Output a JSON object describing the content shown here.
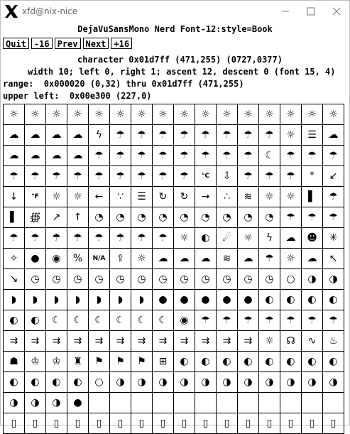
{
  "window": {
    "title": "xfd@nix-nice"
  },
  "font_name": "DejaVuSansMono Nerd Font-12:style=Book",
  "buttons": {
    "quit": "Quit",
    "prev_page": "-16",
    "prev": "Prev",
    "next": "Next",
    "next_page": "+16"
  },
  "info": {
    "character": "character 0x01d7ff (471,255) (0727,0377)",
    "metrics": "width 10; left 0, right 1; ascent 12, descent 0 (font 15, 4)",
    "range": "range:  0x000020 (0,32) thru 0x01d7ff (471,255)",
    "upper_left": "upper left:  0x00e300 (227,0)"
  },
  "glyphs": [
    "☼",
    "☼",
    "☼",
    "☼",
    "☼",
    "☼",
    "☼",
    "☼",
    "☼",
    "☼",
    "☼",
    "☼",
    "☼",
    "☼",
    "☼",
    "☼",
    "☁",
    "☁",
    "☁",
    "☁",
    "ϟ",
    "☂",
    "☂",
    "☂",
    "☂",
    "☂",
    "☂",
    "☂",
    "☂",
    "☼",
    "☰",
    "☁",
    "☁",
    "☁",
    "☁",
    "☁",
    "☂",
    "☂",
    "☂",
    "☂",
    "☂",
    "☂",
    "☂",
    "☂",
    "☾",
    "☂",
    "☂",
    "☂",
    "☂",
    "☂",
    "☂",
    "☂",
    "☂",
    "☂",
    "☂",
    "☂",
    "☂",
    "°C",
    "⇩",
    "☂",
    "☂",
    "☂",
    "°",
    "↙",
    "↓",
    "°F",
    "☼",
    "☼",
    "←",
    "∵",
    "☰",
    "↻",
    "↻",
    "→",
    "∴",
    "≋",
    "☼",
    "☼",
    "▌",
    "☂",
    "▌",
    "∰",
    "↗",
    "↑",
    "◔",
    "◔",
    "◔",
    "◔",
    "◔",
    "◔",
    "◔",
    "◔",
    "◔",
    "☂",
    "☂",
    "☂",
    "☂",
    "☂",
    "☂",
    "☂",
    "☂",
    "☂",
    "☂",
    "☂",
    "☼",
    "◐",
    "☄",
    "☼",
    "ϟ",
    "☁",
    "☻",
    "✳",
    "✧",
    "●",
    "◉",
    "%",
    "N/A",
    "⇪",
    "☼",
    "☁",
    "☁",
    "☁",
    "≋",
    "☁",
    "☂",
    "☼",
    "☁",
    "↖",
    "↘",
    "◷",
    "◷",
    "◷",
    "◷",
    "◷",
    "◷",
    "◷",
    "◷",
    "◷",
    "◷",
    "◷",
    "◷",
    "○",
    "◑",
    "◑",
    "◗",
    "◗",
    "◗",
    "◗",
    "◗",
    "◗",
    "◗",
    "●",
    "●",
    "●",
    "●",
    "●",
    "◐",
    "◐",
    "◐",
    "◐",
    "◐",
    "◐",
    "☾",
    "☾",
    "☾",
    "☾",
    "☾",
    "☾",
    "◉",
    "☂",
    "☂",
    "☂",
    "☂",
    "☂",
    "☂",
    "☂",
    "⇉",
    "⇉",
    "⇉",
    "⇉",
    "⇉",
    "⇉",
    "⇉",
    "⇉",
    "⇉",
    "⇉",
    "⇉",
    "⇉",
    "☼",
    "☊",
    "∿",
    "♨",
    "☗",
    "♔",
    "♔",
    "♜",
    "⚑",
    "⚑",
    "⚑",
    "⊞",
    "◐",
    "◐",
    "◐",
    "◐",
    "◐",
    "◐",
    "◐",
    "◐",
    "◐",
    "◐",
    "◐",
    "◐",
    "○",
    "◑",
    "◑",
    "◑",
    "◑",
    "◑",
    "◑",
    "◑",
    "◑",
    "◑",
    "◑",
    "◑",
    "◑",
    "◑",
    "◑",
    "●",
    "",
    "",
    "",
    "",
    "",
    "",
    "",
    "",
    "",
    "",
    "",
    "",
    "▯",
    "▯",
    "▯",
    "▯",
    "▯",
    "▯",
    "▯",
    "▯",
    "▯",
    "▯",
    "▯",
    "▯",
    "▯",
    "▯",
    "▯",
    "▯"
  ]
}
